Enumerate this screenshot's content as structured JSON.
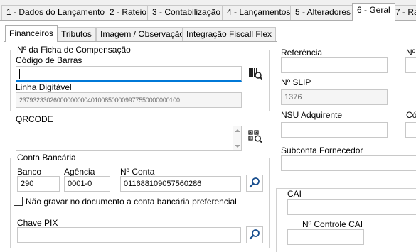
{
  "top_tabs": [
    "1 - Dados do Lançamento",
    "2 - Rateio",
    "3 - Contabilização",
    "4 - Lançamentos",
    "5 - Alteradores",
    "6 - Geral",
    "7 - Ra"
  ],
  "inner_tabs": [
    "Financeiros",
    "Tributos",
    "Imagem / Observação",
    "Integração Fiscall Flex"
  ],
  "ficha": {
    "group_title": "Nº da Ficha de Compensação",
    "codigo_barras_label": "Código de Barras",
    "codigo_barras_value": "",
    "linha_digitavel_label": "Linha Digitável",
    "linha_digitavel_value": "23793233026000000000401008500009977550000000100"
  },
  "qrcode": {
    "label": "QRCODE",
    "value": ""
  },
  "conta": {
    "group_title": "Conta Bancária",
    "banco_label": "Banco",
    "banco_value": "290",
    "agencia_label": "Agência",
    "agencia_value": "0001-0",
    "conta_label": "Nº Conta",
    "conta_value": "011688109057560286",
    "checkbox_label": "Não gravar no documento a conta bancária preferencial",
    "checkbox_checked": false
  },
  "pix": {
    "label": "Chave PIX",
    "value": ""
  },
  "right": {
    "referencia_label": "Referência",
    "referencia_value": "",
    "n_label": "Nº",
    "slip_label": "Nº SLIP",
    "slip_value": "1376",
    "nsu_label": "NSU Adquirente",
    "nsu_value": "",
    "co_label": "Có",
    "subconta_label": "Subconta Fornecedor",
    "subconta_value": "",
    "cai_label": "CAI",
    "cai_value": "",
    "controle_cai_label": "Nº Controle CAI",
    "controle_cai_value": ""
  },
  "icons": {
    "barcode_scan": "barcode-scan-icon",
    "qr_scan": "qrcode-scan-icon",
    "search": "search-icon"
  }
}
